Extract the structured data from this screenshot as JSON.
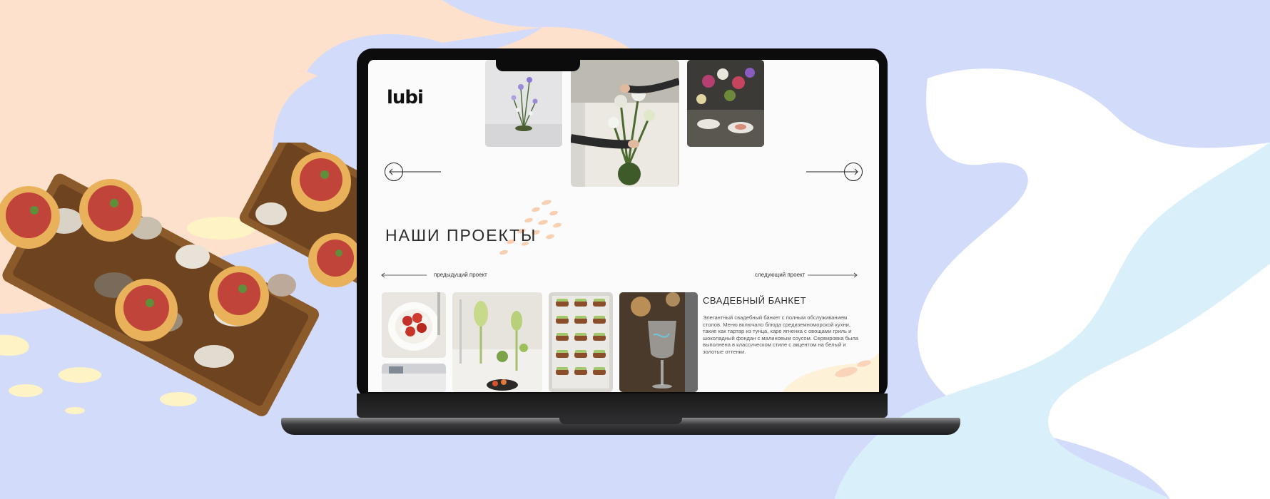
{
  "site": {
    "logo": "lubi",
    "section_title": "НАШИ ПРОЕКТЫ",
    "prev_project": "предыдущий проект",
    "next_project": "следующий проект",
    "project_title": "СВАДЕБНЫЙ БАНКЕТ",
    "project_description": "Элегантный свадебный банкет с полным обслуживанием столов. Меню включало блюда средиземноморской кухни, такие как тартар из тунца, каре ягненка с овощами гриль и шоколадный фондан с малиновым соусом. Сервировка была выполнена в классическом стиле с акцентом на белый и золотые оттенки."
  },
  "colors": {
    "background_blue": "#d3dbfb",
    "background_peach": "#fde1cc",
    "background_light_blue": "#d9f0fb",
    "accent_peach": "#f9c9a8",
    "screen_bg": "#fbfbfb"
  },
  "icons": {
    "carousel_prev": "arrow-left-circle-icon",
    "carousel_next": "arrow-right-circle-icon",
    "project_prev": "arrow-left-icon",
    "project_next": "arrow-right-icon"
  }
}
